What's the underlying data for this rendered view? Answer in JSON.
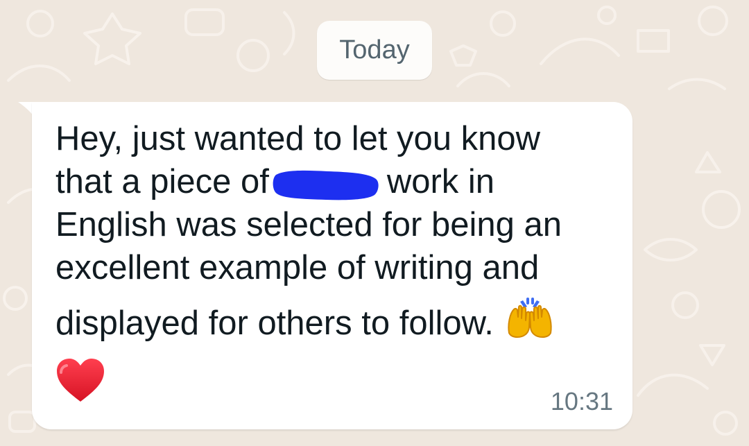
{
  "date_separator": {
    "label": "Today"
  },
  "message": {
    "lines": [
      "Hey, just wanted to let you know",
      "that a piece of",
      "work in",
      "English was selected for being an",
      "excellent example of writing and",
      "displayed for others to follow."
    ],
    "inline_icon": "raised-hands",
    "reaction_icon": "red-heart",
    "time": "10:31",
    "redaction_color": "#1d2ff0"
  }
}
